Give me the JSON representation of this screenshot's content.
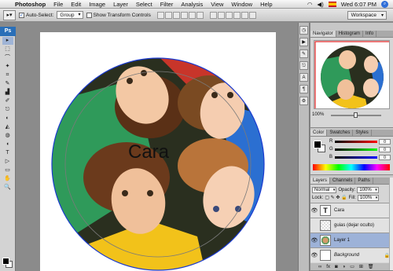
{
  "menubar": {
    "apple": "",
    "app_name": "Photoshop",
    "items": [
      "File",
      "Edit",
      "Image",
      "Layer",
      "Select",
      "Filter",
      "Analysis",
      "View",
      "Window",
      "Help"
    ],
    "clock": "Wed 6:07 PM"
  },
  "options": {
    "auto_select_label": "Auto-Select:",
    "auto_select_value": "Group",
    "transform_label": "Show Transform Controls",
    "workspace_label": "Workspace"
  },
  "tools": {
    "logo": "Ps",
    "icons": [
      "▸",
      "⬚",
      "⌒",
      "✦",
      "⌗",
      "✎",
      "▟",
      "✐",
      "⎋",
      "◐",
      "◭",
      "◍",
      "◖",
      "T",
      "▷",
      "▭",
      "✋",
      "🔍"
    ]
  },
  "canvas": {
    "text_layer": "Cara"
  },
  "navigator": {
    "tabs": [
      "Navigator",
      "Histogram",
      "Info"
    ],
    "zoom": "100%"
  },
  "color": {
    "tabs": [
      "Color",
      "Swatches",
      "Styles"
    ],
    "channels": [
      {
        "label": "R",
        "value": "0",
        "color": "#e02020"
      },
      {
        "label": "G",
        "value": "0",
        "color": "#20a020"
      },
      {
        "label": "B",
        "value": "0",
        "color": "#2020e0"
      }
    ]
  },
  "layers": {
    "tabs": [
      "Layers",
      "Channels",
      "Paths"
    ],
    "blend_mode": "Normal",
    "opacity_label": "Opacity:",
    "opacity_value": "100%",
    "lock_label": "Lock:",
    "fill_label": "Fill:",
    "fill_value": "100%",
    "items": [
      {
        "name": "Cara",
        "type": "text"
      },
      {
        "name": "guias (dejar oculto)",
        "type": "guide"
      },
      {
        "name": "Layer 1",
        "type": "image",
        "selected": true
      },
      {
        "name": "Background",
        "type": "background",
        "locked": true
      }
    ]
  }
}
